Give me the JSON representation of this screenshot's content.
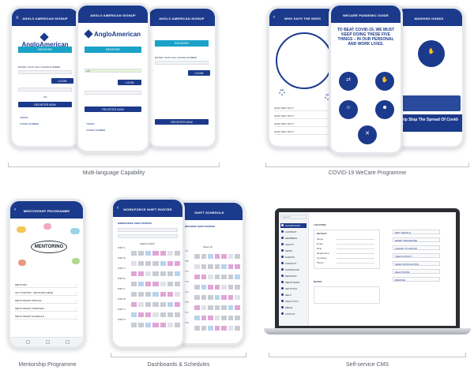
{
  "captions": {
    "multi_language": "Multi-language Capability",
    "covid": "COVID-19 WeCare Programme",
    "mentorship": "Mentorship Programme",
    "dashboards": "Dashboards & Schedules",
    "cms": "Self-service CMS"
  },
  "colors": {
    "brand_blue": "#1c3a8c",
    "teal": "#1aa3c8",
    "pink": "#e0a6d6",
    "grey_cell": "#c8ccd2"
  },
  "multi_language": {
    "bar_title_1": "ANGLO AMERICAN SIGNUP",
    "bar_title_2": "ANGLO AMERICAN SIGNUP",
    "bar_title_3": "ANGLO AMERICAN SIGNUP",
    "logo": "AngloAmerican",
    "register_label": "REGISTER",
    "login_label": "LOGIN",
    "register_now_label": "REGISTER NOW",
    "enter_phone_label": "ENTER YOUR CELL PHONE NUMBER",
    "country_code": "+27",
    "or_label": "OR",
    "link_terms": "TERMS",
    "link_other_number": "OTHER NUMBER"
  },
  "covid": {
    "bar_title_1": "WHO SAYS THE NEED",
    "bar_title_2": "WECARE PANDEMIC GUIDE",
    "bar_title_3": "WASHING HANDS",
    "headline": "TO BEAT COVID-19, WE MUST KEEP DOING THESE FIVE THINGS – IN OUR PERSONAL AND WORK LIVES.",
    "banner": "Help Stop The Spread Of Covid-19",
    "list_items": [
      "HOW THEY DO IT",
      "HOW THEY DO IT",
      "HOW THEY DO IT",
      "HOW THEY DO IT"
    ]
  },
  "mentorship": {
    "bar_title": "MENTORSHIP PROGRAMME",
    "word_center": "MENTORING",
    "rows": [
      "MENTORS",
      "GET STARTED - REGISTER HERE",
      "MENTORSHIP PROFILE",
      "MENTORSHIP OVERVIEW",
      "MENTORSHIP SCHEDULE"
    ]
  },
  "dashboards": {
    "bar_title_1": "WORKFORCE SHIFT ROSTER",
    "bar_title_2": "SHIFT SCHEDULE",
    "header_1": "WORKFORCE SHIFT ROSTER",
    "header_2": "WORKFORCE SHIFT ROSTER",
    "month_label": "MARCH 2020",
    "week_label": "Week 10",
    "rows": [
      "SHIFT A",
      "SHIFT B",
      "SHIFT C",
      "SHIFT D",
      "SHIFT A",
      "SHIFT B",
      "SHIFT C",
      "SHIFT D"
    ]
  },
  "cms": {
    "search_placeholder": "Search",
    "sidebar": [
      "DASHBOARD",
      "CONTENT",
      "MEMBERS",
      "SHIFTS",
      "NEWS",
      "EVENTS",
      "SURVEYS",
      "CAMPAIGNS",
      "REPORTS",
      "MENTORING",
      "SETTINGS",
      "HELP",
      "ANALYTICS",
      "MEDIA",
      "LOGOUT"
    ],
    "section_title": "LOCATION",
    "details_title": "DETAILS",
    "fields": [
      "Name",
      "Email",
      "Role",
      "Department",
      "Company",
      "Phone"
    ],
    "notes_title": "NOTES",
    "actions": [
      "EDIT DETAILS",
      "RESET PASSWORD",
      "ASSIGN TO GROUP",
      "VIEW ACTIVITY",
      "SEND NOTIFICATION",
      "DEACTIVATE",
      "REMOVE"
    ]
  }
}
